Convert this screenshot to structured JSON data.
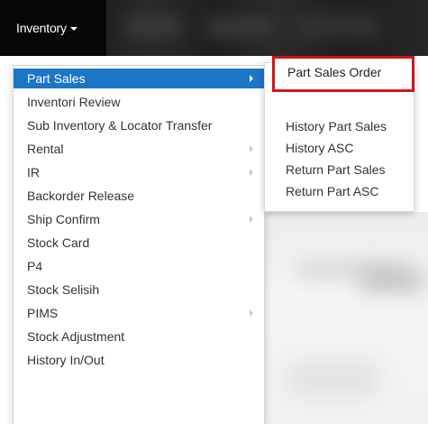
{
  "navbar": {
    "menu_label": "Inventory"
  },
  "dropdown": {
    "items": [
      {
        "label": "Part Sales",
        "has_submenu": true,
        "active": true
      },
      {
        "label": "Inventori Review"
      },
      {
        "label": "Sub Inventory & Locator Transfer"
      },
      {
        "label": "Rental",
        "has_submenu": true
      },
      {
        "label": "IR",
        "has_submenu": true
      },
      {
        "label": "Backorder Release"
      },
      {
        "label": "Ship Confirm",
        "has_submenu": true
      },
      {
        "label": "Stock Card"
      },
      {
        "label": "P4"
      },
      {
        "label": "Stock Selisih"
      },
      {
        "label": "PIMS",
        "has_submenu": true
      },
      {
        "label": "Stock Adjustment"
      },
      {
        "label": "History In/Out"
      }
    ]
  },
  "submenu": {
    "items": [
      {
        "label": "Part Sales Order",
        "highlighted": true
      },
      {
        "label": "History Part Sales"
      },
      {
        "label": "History ASC"
      },
      {
        "label": "Return Part Sales"
      },
      {
        "label": "Return Part ASC"
      }
    ]
  },
  "colors": {
    "active_bg": "#1b76c7",
    "highlight_border": "#d4141b",
    "navbar_bg": "#070707"
  }
}
